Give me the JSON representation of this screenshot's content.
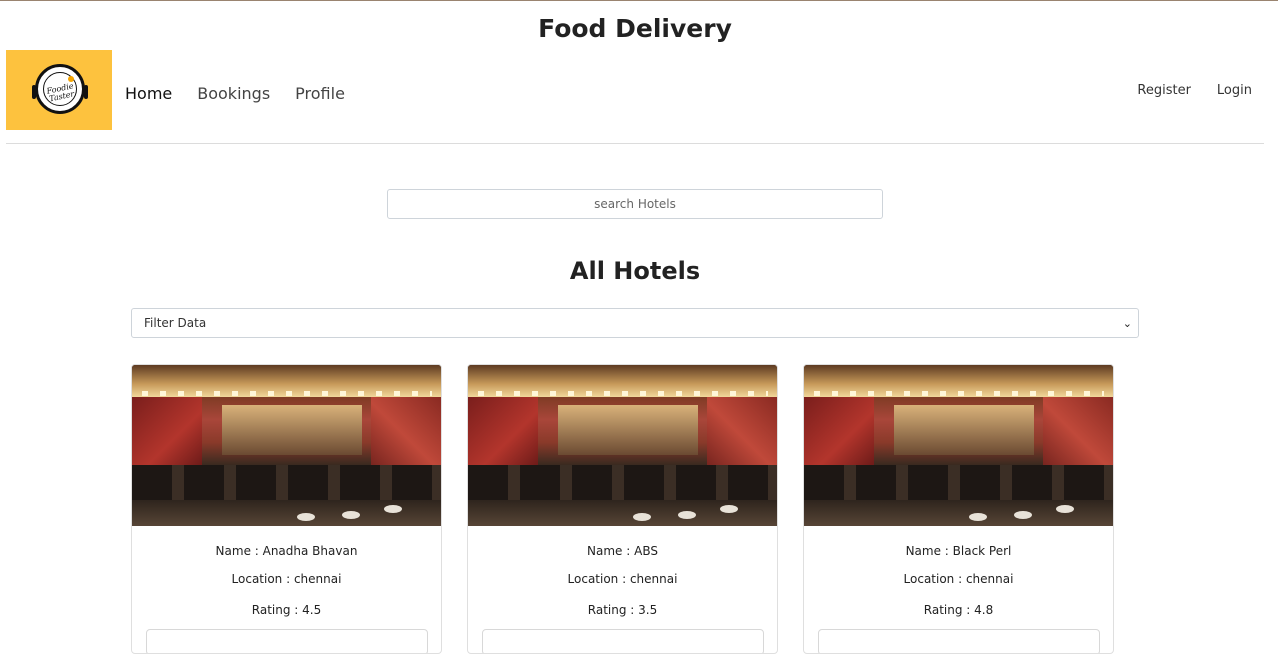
{
  "app": {
    "title": "Food Delivery"
  },
  "logo": {
    "text": "Foodie Taster"
  },
  "nav": {
    "links": [
      "Home",
      "Bookings",
      "Profile"
    ],
    "auth": [
      "Register",
      "Login"
    ]
  },
  "search": {
    "placeholder": "search Hotels"
  },
  "section": {
    "title": "All Hotels"
  },
  "filter": {
    "selected": "Filter Data"
  },
  "hotels": [
    {
      "name": "Name : Anadha Bhavan",
      "location": "Location : chennai",
      "rating": "Rating : 4.5"
    },
    {
      "name": "Name : ABS",
      "location": "Location : chennai",
      "rating": "Rating : 3.5"
    },
    {
      "name": "Name : Black Perl",
      "location": "Location : chennai",
      "rating": "Rating : 4.8"
    }
  ],
  "colors": {
    "logo_bg": "#fdc23e",
    "border": "#ced4da"
  }
}
